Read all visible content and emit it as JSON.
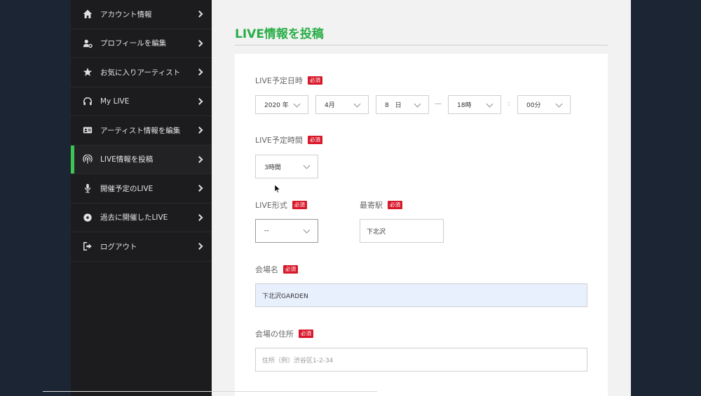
{
  "sidebar": {
    "items": [
      {
        "label": "アカウント情報",
        "icon": "home-icon"
      },
      {
        "label": "プロフィールを編集",
        "icon": "user-gear-icon"
      },
      {
        "label": "お気に入りアーティスト",
        "icon": "star-icon"
      },
      {
        "label": "My LIVE",
        "icon": "headphones-icon"
      },
      {
        "label": "アーティスト情報を編集",
        "icon": "id-card-icon"
      },
      {
        "label": "LIVE情報を投稿",
        "icon": "broadcast-icon",
        "active": true
      },
      {
        "label": "開催予定のLIVE",
        "icon": "microphone-icon"
      },
      {
        "label": "過去に開催したLIVE",
        "icon": "record-icon"
      },
      {
        "label": "ログアウト",
        "icon": "sign-out-icon"
      }
    ]
  },
  "page": {
    "title": "LIVE情報を投稿"
  },
  "form": {
    "required_badge": "必須",
    "datetime": {
      "label": "LIVE予定日時",
      "year": "2020 年",
      "month": "4月",
      "day": "8　日",
      "range_sep": "—",
      "hour": "18時",
      "time_sep": ":",
      "minute": "00分"
    },
    "duration": {
      "label": "LIVE予定時間",
      "value": "3時間"
    },
    "format": {
      "label": "LIVE形式",
      "value": "--"
    },
    "station": {
      "label": "最寄駅",
      "value": "下北沢"
    },
    "venue": {
      "label": "会場名",
      "value": "下北沢GARDEN"
    },
    "address": {
      "label": "会場の住所",
      "placeholder": "住所（例）渋谷区1-2-34"
    }
  },
  "colors": {
    "accent": "#2aae48",
    "required": "#d8192a",
    "sidebar_bg": "#1c1c1e",
    "active_bar": "#3ec552"
  }
}
